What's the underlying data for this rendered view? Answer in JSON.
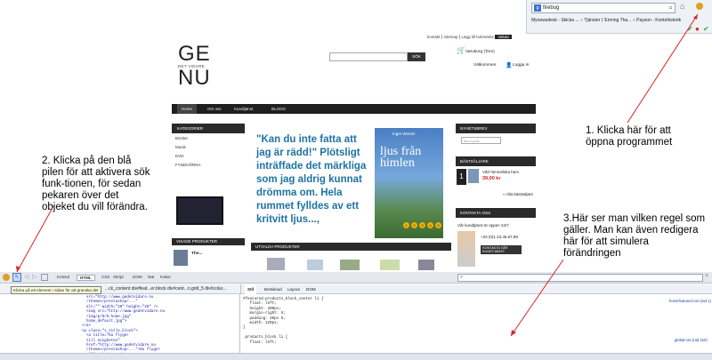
{
  "browser": {
    "search_text": "firebug",
    "search_engine_icon": "google-icon",
    "bookmarks": "Mynewsdesk - Skicka ...   ○ Tjänster | 'Emring Tha...   ○ Payson - Kontohistorik"
  },
  "site": {
    "toplinks": [
      "kontakt",
      "sitemap",
      "Lägg till bokmärke",
      "Valuta"
    ],
    "logo_top": "GE",
    "logo_middle": "DET VIDARE",
    "logo_bottom": "NU",
    "search_button": "SÖK",
    "cart": "Varukorg (Tom)",
    "welcome": "Välkommen",
    "login": "Logga in",
    "nav": [
      "Home",
      "Om oss",
      "Kundtjänst",
      "BLOGG"
    ],
    "categories_title": "KATEGORIER",
    "categories": [
      "Böcker",
      "Musik",
      "DVD",
      "FYNDHÖRNA"
    ],
    "hero_quote": "\"Kan du inte fatta att jag är rädd!\" Plötsligt inträffade det märkliga som jag aldrig kunnat drömma om. Hela rummet fylldes av ett kritvitt ljus...,",
    "book_author": "Inger Winsér",
    "book_title": "ljus från himlen",
    "slider_dots": [
      "1",
      "2",
      "3",
      "4",
      "5"
    ],
    "newsletter_title": "NYHETSBREV",
    "newsletter_placeholder": "din e-post",
    "bestsellers_title": "BÄSTSÄLJARE",
    "bestseller_rank": "1",
    "bestseller_name": "Vårt himmelska hem",
    "bestseller_price": "39,00 kr",
    "all_bestsellers": "» Alla bästsäljare",
    "contact_title": "KONTAKTA OSS",
    "contact_text": "Vår kundtjänst är öppen 24/7",
    "contact_phone": "+33 (0)1.23.45.67.89",
    "contact_button": "KONTAKTA VÅR KUNDTJÄNST",
    "viewed_title": "VISADE PRODUKTER",
    "viewed_item": "The...",
    "featured_title": "UTVALDA PRODUKTER"
  },
  "firebug": {
    "tabs": [
      "Konsol",
      "HTML",
      "CSS",
      "Skript",
      "DOM",
      "Nät",
      "Kakor"
    ],
    "active_tab": "HTML",
    "tooltip": "Klicka på ett element i sidan för att granska det",
    "breadcrumb": "...ck_content  div#feat...er.block  div#cent...n.grid_5  div#colur...",
    "right_tabs": [
      "Stil",
      "Beräknad",
      "Layout",
      "DOM"
    ],
    "html_code": "  src=\"http://www.gedetvidare.nu\n  /themes/prestashop/...\"\n  alt=\"\" width=\"20\" height=\"20\" />\n  <img src=\"http://www.gedetvidare.nu\n  /img/p/9/9-home.jpg\"\n  home_default.jpg\">\n</a>\n<p class=\"s_title_block\">\n  <a title=\"Du flyger\n  till evigheten\"\n  href=\"http://www.gedetvidare.nu\n  /themes/prestashop/...\">Du flyger\n  till evigheten</a>",
    "css_code": "#featured-products_block_center li {\n   float: left;\n   height: 200px;\n   margin-right: 5;\n   padding: 20px 5;\n   width: 120px;\n}\n\n.products_block li {\n   float: left;",
    "css_file1": "homefeatured.css (rad 1)",
    "css_file2": "global.css (rad 310)"
  },
  "annotations": {
    "a1": "1. Klicka här för att öppna programmet",
    "a2": "2. Klicka på den blå pilen för att aktivera sök funk-tionen, för sedan pekaren över det objeket du vill förändra.",
    "a3": "3.Här ser man vilken regel som gäller. Man kan även redigera här för att simulera förändringen"
  },
  "colors": {
    "annotation_line": "#dd2222",
    "hero_text": "#1d73a3",
    "nav": "#1f1f1f"
  }
}
